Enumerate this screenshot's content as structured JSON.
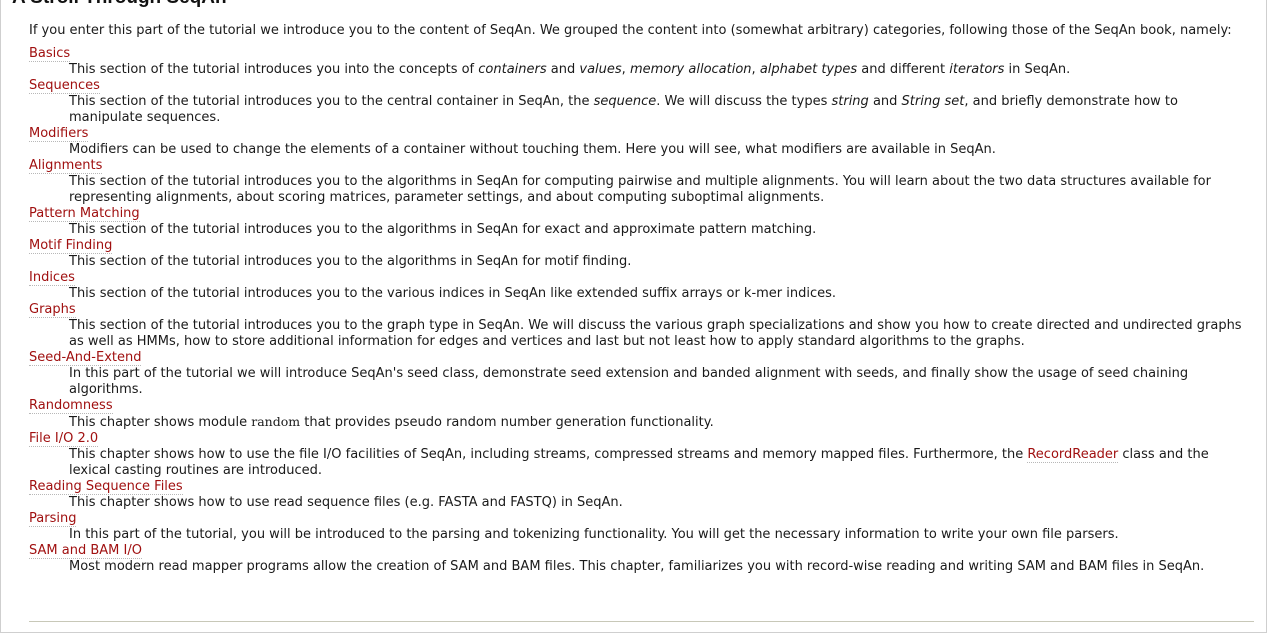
{
  "heading": "A Stroll Through SeqAn",
  "intro": "If you enter this part of the tutorial we introduce you to the content of SeqAn. We grouped the content into (somewhat arbitrary) categories, following those of the SeqAn book, namely:",
  "sections": [
    {
      "title": "Basics",
      "desc": [
        {
          "t": "This section of the tutorial introduces you into the concepts of "
        },
        {
          "t": "containers",
          "em": true
        },
        {
          "t": " and "
        },
        {
          "t": "values",
          "em": true
        },
        {
          "t": ", "
        },
        {
          "t": "memory allocation",
          "em": true
        },
        {
          "t": ", "
        },
        {
          "t": "alphabet types",
          "em": true
        },
        {
          "t": " and different "
        },
        {
          "t": "iterators",
          "em": true
        },
        {
          "t": " in SeqAn."
        }
      ]
    },
    {
      "title": "Sequences",
      "desc": [
        {
          "t": "This section of the tutorial introduces you to the central container in SeqAn, the "
        },
        {
          "t": "sequence",
          "em": true
        },
        {
          "t": ". We will discuss the types "
        },
        {
          "t": "string",
          "em": true
        },
        {
          "t": " and "
        },
        {
          "t": "String set",
          "em": true
        },
        {
          "t": ", and briefly demonstrate how to manipulate sequences."
        }
      ]
    },
    {
      "title": "Modifiers",
      "desc": [
        {
          "t": "Modifiers can be used to change the elements of a container without touching them. Here you will see, what modifiers are available in SeqAn."
        }
      ]
    },
    {
      "title": "Alignments",
      "desc": [
        {
          "t": "This section of the tutorial introduces you to the algorithms in SeqAn for computing pairwise and multiple alignments. You will learn about the two data structures available for representing alignments, about scoring matrices, parameter settings, and about computing suboptimal alignments."
        }
      ]
    },
    {
      "title": "Pattern Matching",
      "desc": [
        {
          "t": "This section of the tutorial introduces you to the algorithms in SeqAn for exact and approximate pattern matching."
        }
      ]
    },
    {
      "title": "Motif Finding",
      "desc": [
        {
          "t": "This section of the tutorial introduces you to the algorithms in SeqAn for motif finding."
        }
      ]
    },
    {
      "title": "Indices",
      "desc": [
        {
          "t": "This section of the tutorial introduces you to the various indices in SeqAn like extended suffix arrays or k-mer indices."
        }
      ]
    },
    {
      "title": "Graphs",
      "desc": [
        {
          "t": "This section of the tutorial introduces you to the graph type in SeqAn. We will discuss the various graph specializations and show you how to create directed and undirected graphs as well as HMMs, how to store additional information for edges and vertices and last but not least how to apply standard algorithms to the graphs."
        }
      ]
    },
    {
      "title": "Seed-And-Extend",
      "desc": [
        {
          "t": "In this part of the tutorial we will introduce SeqAn's seed class, demonstrate seed extension and banded alignment with seeds, and finally show the usage of seed chaining algorithms."
        }
      ]
    },
    {
      "title": "Randomness",
      "desc": [
        {
          "t": "This chapter shows module "
        },
        {
          "t": "random",
          "code": true
        },
        {
          "t": " that provides pseudo random number generation functionality."
        }
      ]
    },
    {
      "title": "File I/O 2.0",
      "desc": [
        {
          "t": "This chapter shows how to use the file I/O facilities of SeqAn, including streams, compressed streams and memory mapped files. Furthermore, the "
        },
        {
          "t": "RecordReader",
          "link": true
        },
        {
          "t": " class and the lexical casting routines are introduced."
        }
      ]
    },
    {
      "title": "Reading Sequence Files",
      "desc": [
        {
          "t": "This chapter shows how to use read sequence files (e.g. FASTA and FASTQ) in SeqAn."
        }
      ]
    },
    {
      "title": "Parsing",
      "desc": [
        {
          "t": "In this part of the tutorial, you will be introduced to the parsing and tokenizing functionality. You will get the necessary information to write your own file parsers."
        }
      ]
    },
    {
      "title": "SAM and BAM I/O",
      "desc": [
        {
          "t": "Most modern read mapper programs allow the creation of SAM and BAM files. This chapter, familiarizes you with record-wise reading and writing SAM and BAM files in SeqAn."
        }
      ]
    }
  ]
}
